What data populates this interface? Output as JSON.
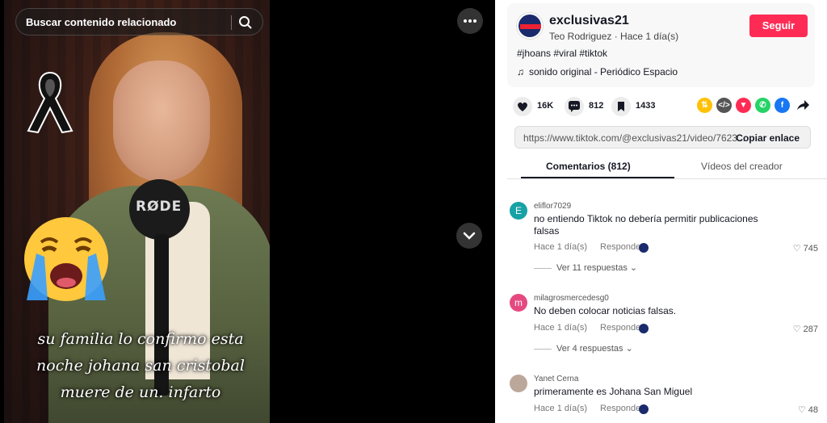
{
  "video": {
    "search_placeholder": "Buscar contenido relacionado",
    "mic_brand": "RØDE",
    "caption_lines": [
      "su familia lo confirmo esta",
      "noche johana san cristobal",
      "muere de un. infarto"
    ]
  },
  "author": {
    "username": "exclusivas21",
    "meta": "Teo Rodriguez · Hace 1 día(s)",
    "follow_label": "Seguir",
    "hashtags": "#jhoans #viral #tiktok",
    "music_icon": "♫",
    "music": "sonido original - Periódico Espacio"
  },
  "actions": {
    "likes": "16K",
    "comments": "812",
    "saves": "1433",
    "share_icons": [
      "repost-icon",
      "embed-icon",
      "send-icon",
      "whatsapp-icon",
      "facebook-icon",
      "share-arrow-icon"
    ]
  },
  "link": {
    "url": "https://www.tiktok.com/@exclusivas21/video/7623...",
    "copy_label": "Copiar enlace"
  },
  "tabs": {
    "comments": "Comentarios (812)",
    "creator_videos": "Vídeos del creador"
  },
  "comments": [
    {
      "avatar_letter": "E",
      "avatar_color": "#17a2a6",
      "user": "eliflor7029",
      "text": "no entiendo Tiktok no debería permitir publicaciones falsas",
      "time": "Hace 1 día(s)",
      "reply": "Responder",
      "likes": "745",
      "view_replies": "Ver 11 respuestas"
    },
    {
      "avatar_letter": "m",
      "avatar_color": "#e64980",
      "user": "milagrosmercedesg0",
      "text": "No deben colocar noticias falsas.",
      "time": "Hace 1 día(s)",
      "reply": "Responder",
      "likes": "287",
      "view_replies": "Ver 4 respuestas"
    },
    {
      "avatar_letter": "",
      "avatar_color": "#bca89a",
      "user": "Yanet Cerna",
      "text": "primeramente es Johana San Miguel",
      "time": "Hace 1 día(s)",
      "reply": "Responder",
      "likes": "48"
    }
  ]
}
